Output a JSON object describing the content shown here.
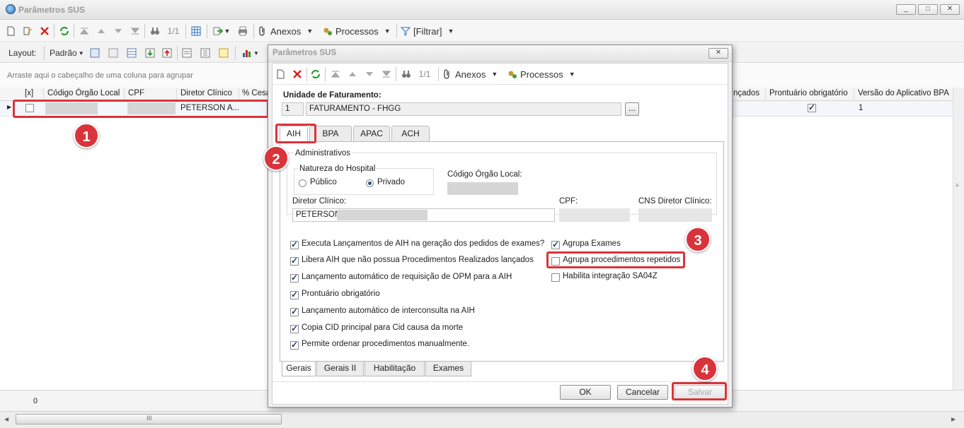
{
  "window": {
    "title": "Parâmetros SUS",
    "minimize": "_",
    "maximize": "□",
    "close": "✕"
  },
  "toolbar": {
    "record_nav": "1/1",
    "anexos": "Anexos",
    "processos": "Processos",
    "filtrar": "[Filtrar]",
    "dropdown_arrow": "▼"
  },
  "layout_bar": {
    "layout_label": "Layout:",
    "padrao": "Padrão"
  },
  "grouping_hint": "Arraste aqui o cabeçalho de uma coluna para agrupar",
  "grid": {
    "columns": {
      "check": "[x]",
      "codigo": "Código Órgão Local",
      "cpf": "CPF",
      "diretor": "Diretor Clínico",
      "cesar": "% Cesa",
      "lancados": "nçados",
      "prontuario": "Prontuário obrigatório",
      "versao": "Versão do Aplicativo BPA"
    },
    "row": {
      "diretor": "PETERSON A...",
      "versao": "1",
      "prontuario_checked": true,
      "checked": false
    }
  },
  "footer": {
    "count": "0",
    "scroll_grip": "III"
  },
  "dialog": {
    "title": "Parâmetros SUS",
    "close": "✕",
    "record_nav": "1/1",
    "anexos": "Anexos",
    "processos": "Processos",
    "unidade_label": "Unidade de Faturamento:",
    "unidade_code": "1",
    "unidade_name": "FATURAMENTO - FHGG",
    "browse": "...",
    "tabs": [
      "AIH",
      "BPA",
      "APAC",
      "ACH"
    ],
    "group_title": "Administrativos",
    "natureza_title": "Natureza do Hospital",
    "natureza_publico": "Público",
    "natureza_privado": "Privado",
    "natureza_selected": "Privado",
    "codigo_label": "Código Órgão Local:",
    "diretor_label": "Diretor Clínico:",
    "diretor_value": "PETERSON",
    "cpf_label": "CPF:",
    "cns_label": "CNS Diretor Clínico:",
    "options_left": [
      {
        "label": "Executa Lançamentos de AIH na geração dos pedidos de exames?",
        "checked": true
      },
      {
        "label": "Libera AIH que não possua Procedimentos Realizados lançados",
        "checked": true
      },
      {
        "label": "Lançamento automático de requisição de OPM para a AIH",
        "checked": true
      },
      {
        "label": "Prontuário obrigatório",
        "checked": true
      },
      {
        "label": "Lançamento automático de interconsulta na AIH",
        "checked": true
      },
      {
        "label": "Copia CID principal para Cid causa da morte",
        "checked": true
      },
      {
        "label": "Permite ordenar procedimentos manualmente.",
        "checked": true
      }
    ],
    "options_right": [
      {
        "label": "Agrupa Exames",
        "checked": true
      },
      {
        "label": "Agrupa procedimentos repetidos",
        "checked": false
      },
      {
        "label": "Habilita integração SA04Z",
        "checked": false
      }
    ],
    "bottom_tabs": [
      "Gerais",
      "Gerais II",
      "Habilitação",
      "Exames"
    ],
    "ok": "OK",
    "cancelar": "Cancelar",
    "salvar": "Salvar"
  },
  "annotations": [
    "1",
    "2",
    "3",
    "4"
  ],
  "colors": {
    "annotation_red": "#d9343b",
    "accent_blue": "#2a6fb0"
  }
}
